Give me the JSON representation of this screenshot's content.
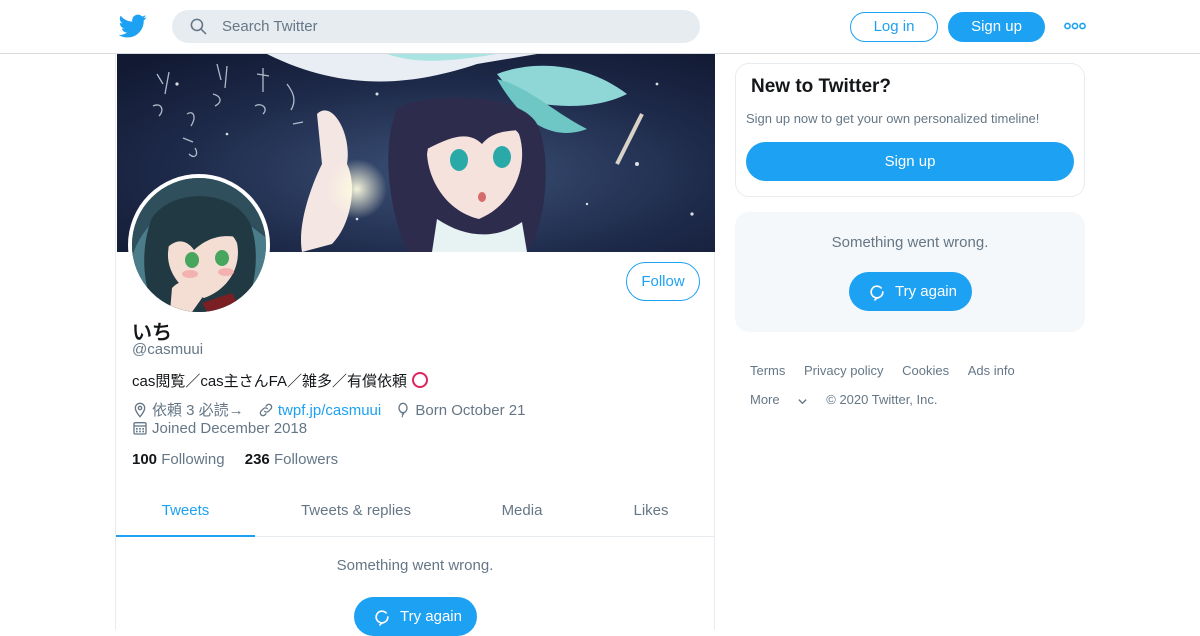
{
  "header": {
    "search_placeholder": "Search Twitter",
    "login_label": "Log in",
    "signup_label": "Sign up",
    "brand_color": "#1da1f2"
  },
  "profile": {
    "display_name": "いち",
    "handle": "@casmuui",
    "bio": "cas閲覧／cas主さんFA／雑多／有償依頼",
    "location": "依頼 3 必読→",
    "website": "twpf.jp/casmuui",
    "birthday": "Born October 21",
    "joined": "Joined December 2018",
    "following_count": "100",
    "following_label": "Following",
    "followers_count": "236",
    "followers_label": "Followers",
    "follow_label": "Follow"
  },
  "tabs": [
    {
      "label": "Tweets",
      "active": true
    },
    {
      "label": "Tweets & replies",
      "active": false
    },
    {
      "label": "Media",
      "active": false
    },
    {
      "label": "Likes",
      "active": false
    }
  ],
  "timeline": {
    "error_message": "Something went wrong.",
    "retry_label": "Try again"
  },
  "sidebar": {
    "new_title": "New to Twitter?",
    "new_text": "Sign up now to get your own personalized timeline!",
    "signup_label": "Sign up",
    "error_message": "Something went wrong.",
    "retry_label": "Try again"
  },
  "footer": {
    "links": [
      "Terms",
      "Privacy policy",
      "Cookies",
      "Ads info"
    ],
    "more_label": "More",
    "copyright": "© 2020 Twitter, Inc."
  },
  "icons": {
    "logo": "twitter-bird-icon",
    "search": "search-icon",
    "more": "more-dots-icon",
    "location": "location-pin-icon",
    "link": "link-icon",
    "birthday": "balloon-icon",
    "calendar": "calendar-icon",
    "retry": "refresh-icon",
    "more_chevron": "chevron-down-icon"
  }
}
